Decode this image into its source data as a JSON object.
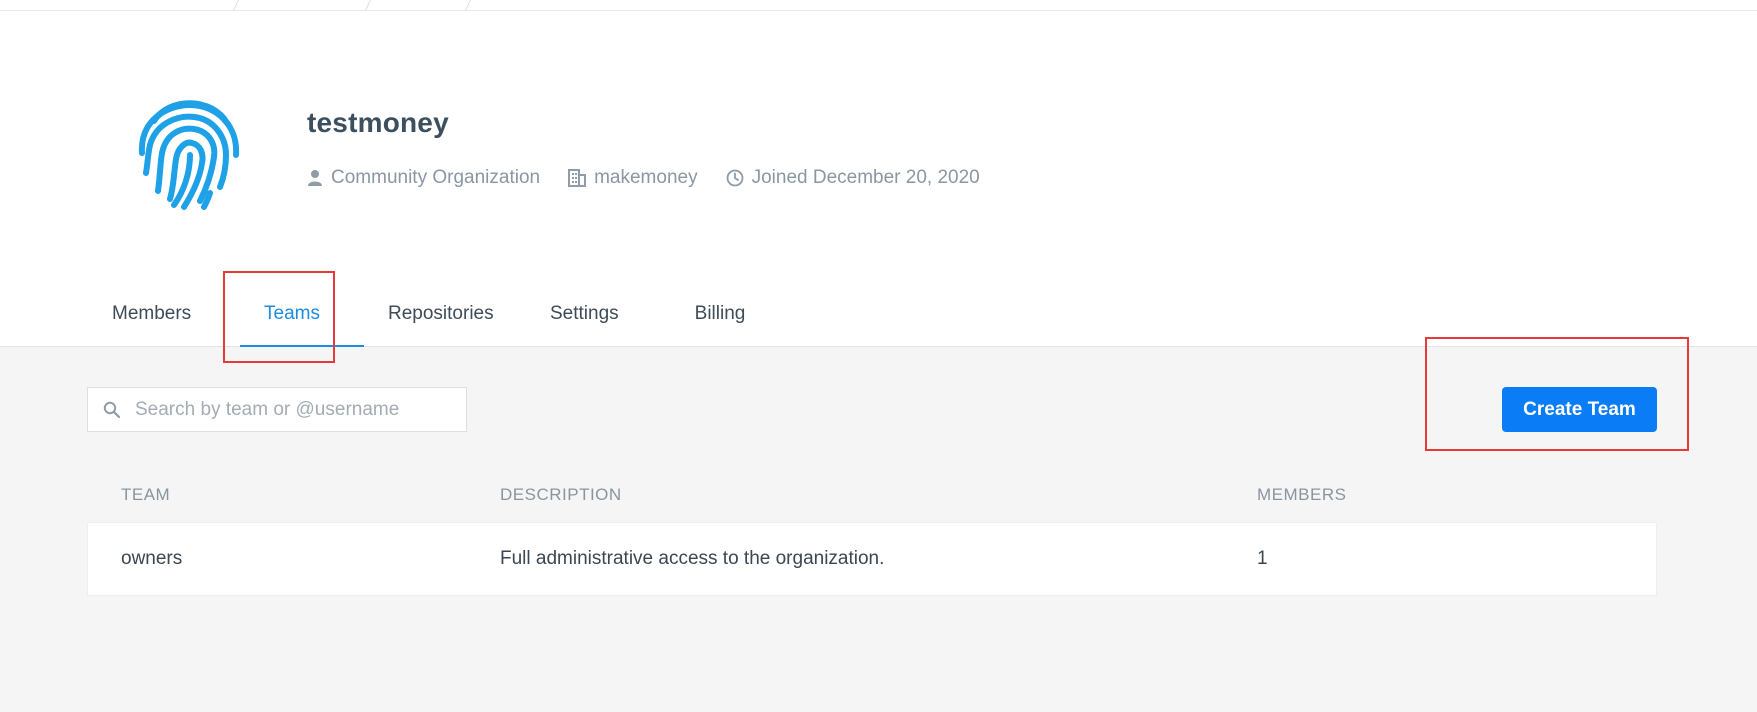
{
  "org": {
    "name": "testmoney",
    "type": "Community Organization",
    "company": "makemoney",
    "joined": "Joined December 20, 2020"
  },
  "tabs": [
    {
      "label": "Members",
      "active": false
    },
    {
      "label": "Teams",
      "active": true
    },
    {
      "label": "Repositories",
      "active": false
    },
    {
      "label": "Settings",
      "active": false
    },
    {
      "label": "Billing",
      "active": false
    }
  ],
  "search": {
    "placeholder": "Search by team or @username",
    "value": ""
  },
  "actions": {
    "create_team_label": "Create Team"
  },
  "table": {
    "headers": [
      "TEAM",
      "DESCRIPTION",
      "MEMBERS"
    ],
    "rows": [
      {
        "team": "owners",
        "description": "Full administrative access to the organization.",
        "members": "1"
      }
    ]
  },
  "icons": {
    "avatar": "fingerprint-icon",
    "org_type": "user-icon",
    "company": "building-icon",
    "joined": "clock-icon",
    "search": "search-icon"
  },
  "colors": {
    "accent": "#1c8de0",
    "primary_button": "#0a7cf5",
    "highlight": "#e8393a"
  }
}
